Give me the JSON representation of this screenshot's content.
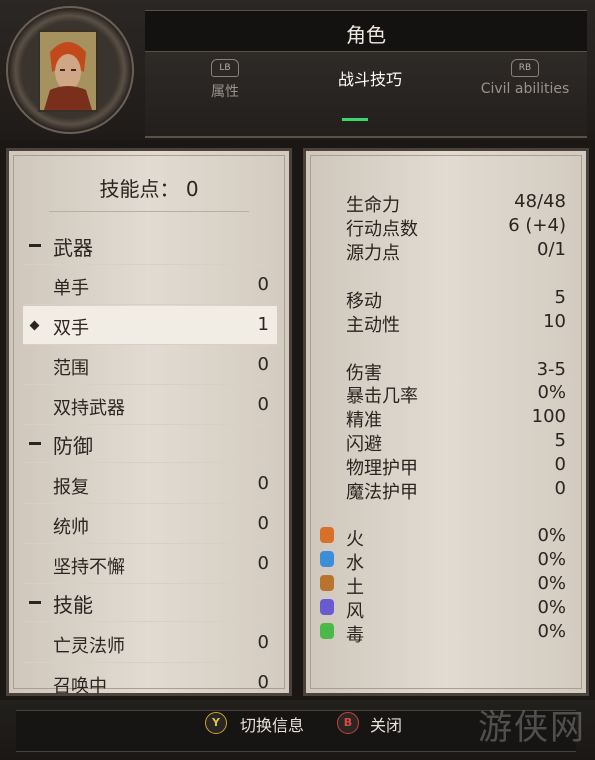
{
  "header": {
    "title": "角色",
    "tabs": [
      {
        "button": "LB",
        "label": "属性"
      },
      {
        "button": "",
        "label": "战斗技巧"
      },
      {
        "button": "RB",
        "label": "Civil abilities"
      }
    ],
    "active_tab_color": "#3bd76e"
  },
  "skills": {
    "points_label": "技能点：",
    "points_value": "0",
    "rows": [
      {
        "type": "category",
        "label": "武器",
        "value": ""
      },
      {
        "type": "skill",
        "label": "单手",
        "value": "0"
      },
      {
        "type": "skill",
        "label": "双手",
        "value": "1",
        "selected": true
      },
      {
        "type": "skill",
        "label": "范围",
        "value": "0"
      },
      {
        "type": "skill",
        "label": "双持武器",
        "value": "0"
      },
      {
        "type": "category",
        "label": "防御",
        "value": ""
      },
      {
        "type": "skill",
        "label": "报复",
        "value": "0"
      },
      {
        "type": "skill",
        "label": "统帅",
        "value": "0"
      },
      {
        "type": "skill",
        "label": "坚持不懈",
        "value": "0"
      },
      {
        "type": "category",
        "label": "技能",
        "value": ""
      },
      {
        "type": "skill",
        "label": "亡灵法师",
        "value": "0"
      },
      {
        "type": "skill",
        "label": "召唤中",
        "value": "0"
      }
    ]
  },
  "stats": {
    "group1": [
      {
        "label": "生命力",
        "value": "48/48"
      },
      {
        "label": "行动点数",
        "value": "6 (+4)"
      },
      {
        "label": "源力点",
        "value": "0/1"
      }
    ],
    "group2": [
      {
        "label": "移动",
        "value": "5"
      },
      {
        "label": "主动性",
        "value": "10"
      }
    ],
    "group3": [
      {
        "label": "伤害",
        "value": "3-5"
      },
      {
        "label": "暴击几率",
        "value": "0%"
      },
      {
        "label": "精准",
        "value": "100"
      },
      {
        "label": "闪避",
        "value": "5"
      },
      {
        "label": "物理护甲",
        "value": "0"
      },
      {
        "label": "魔法护甲",
        "value": "0"
      }
    ],
    "resistances": [
      {
        "label": "火",
        "value": "0%",
        "icon": "fire-icon",
        "color": "#d8702a"
      },
      {
        "label": "水",
        "value": "0%",
        "icon": "water-icon",
        "color": "#3a8fd8"
      },
      {
        "label": "土",
        "value": "0%",
        "icon": "earth-icon",
        "color": "#b8732e"
      },
      {
        "label": "风",
        "value": "0%",
        "icon": "air-icon",
        "color": "#6a5ad0"
      },
      {
        "label": "毒",
        "value": "0%",
        "icon": "poison-icon",
        "color": "#4cb84a"
      }
    ]
  },
  "footer": {
    "y_button": "Y",
    "y_label": "切换信息",
    "b_button": "B",
    "b_label": "关闭"
  },
  "watermark": "游侠网"
}
